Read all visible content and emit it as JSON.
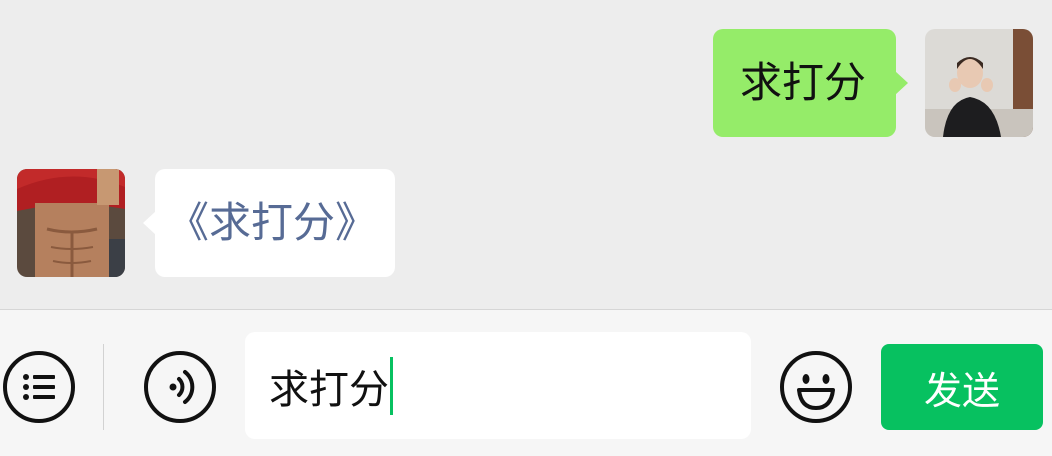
{
  "messages": [
    {
      "sender": "me",
      "text": "求打分"
    },
    {
      "sender": "other",
      "text": "《求打分》"
    }
  ],
  "input_bar": {
    "menu_icon": "menu-list-icon",
    "voice_icon": "voice-icon",
    "emoji_icon": "emoji-icon",
    "input_value": "求打分",
    "send_label": "发送"
  },
  "colors": {
    "chat_background": "#ededed",
    "my_bubble": "#95ec69",
    "other_bubble": "#ffffff",
    "other_text": "#576b95",
    "accent": "#07c160"
  }
}
